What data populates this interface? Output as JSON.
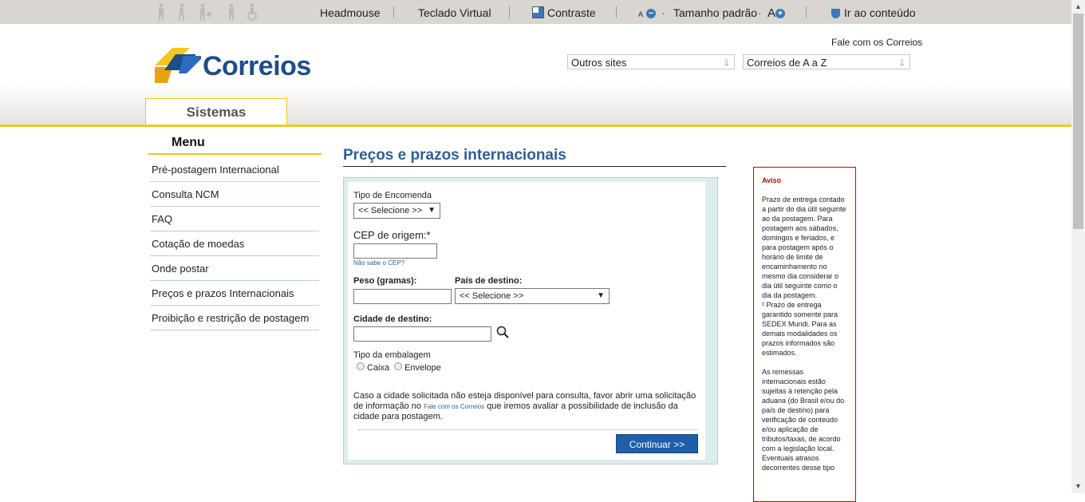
{
  "topbar": {
    "headmouse": "Headmouse",
    "teclado": "Teclado Virtual",
    "contraste": "Contraste",
    "font_small": "A",
    "tamanho": "Tamanho padrão",
    "font_large": "A",
    "ir_conteudo": "Ir ao conteúdo"
  },
  "header": {
    "logo_text": "Correios",
    "fale": "Fale com os Correios",
    "outros_sites": "Outros sites",
    "correios_az": "Correios de A a Z",
    "tab": "Sistemas"
  },
  "menu": {
    "title": "Menu",
    "items": [
      "Pré-postagem Internacional",
      "Consulta NCM",
      "FAQ",
      "Cotação de moedas",
      "Onde postar",
      "Preços e prazos Internacionais",
      "Proibição e restrição de postagem"
    ]
  },
  "main": {
    "title": "Preços e prazos internacionais",
    "tipo_encomenda_label": "Tipo de Encomenda",
    "tipo_encomenda_value": "<< Selecione >>",
    "cep_label": "CEP de origem:*",
    "cep_value": "",
    "nao_sabe_cep": "Não sabe o CEP?",
    "peso_label": "Peso (gramas):",
    "peso_value": "",
    "pais_label": "País de destino:",
    "pais_value": "<< Selecione >>",
    "cidade_label": "Cidade de destino:",
    "cidade_value": "",
    "embalagem_label": "Tipo da embalagem",
    "caixa": "Caixa",
    "envelope": "Envelope",
    "info_part1": "Caso a cidade solicitada não esteja disponível para consulta, favor abrir uma solicitação de informação no",
    "info_link": "Fale com os Correios",
    "info_part2": "que iremos avaliar a possibilidade de inclusão da cidade para postagem.",
    "continuar": "Continuar >>"
  },
  "aviso": {
    "title": "Aviso",
    "p1": "Prazo de entrega contado a partir do dia útil seguinte ao da postagem. Para postagem aos sábados, domingos e feriados, e para postagem após o horário de limite de encaminhamento no mesmo dia considerar o dia útil seguinte como o dia da postagem.",
    "p2": "¹ Prazo de entrega garantido somente para SEDEX Mundi. Para as demais modalidades os prazos informados são estimados.",
    "p3": "As remessas internacionais estão sujeitas à retenção pela aduana (do Brasil e/ou do país de destino) para verificação de conteúdo e/ou aplicação de tributos/taxas, de acordo com a legislação local. Eventuais atrasos decorrentes desse tipo"
  },
  "colors": {
    "brand_yellow": "#f2c81a",
    "brand_blue": "#1f4c8a",
    "title_blue": "#2e5f95",
    "aviso_red": "#cc0000"
  }
}
